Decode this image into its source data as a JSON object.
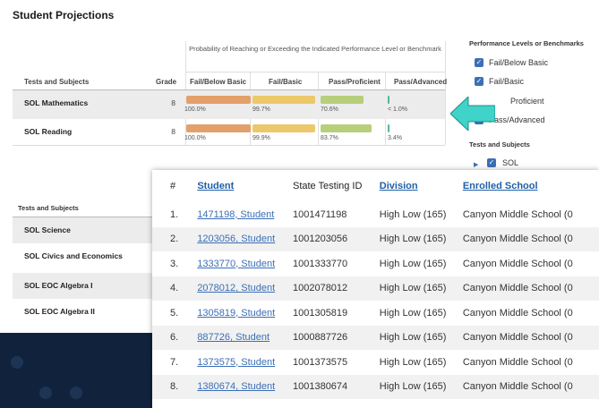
{
  "title": "Student Projections",
  "projection_table": {
    "prob_header": "Probability of Reaching or Exceeding the Indicated Performance Level or Benchmark",
    "col_tests": "Tests and Subjects",
    "col_grade": "Grade",
    "levels": [
      "Fail/Below Basic",
      "Fail/Basic",
      "Pass/Proficient",
      "Pass/Advanced"
    ],
    "rows": [
      {
        "subject": "SOL Mathematics",
        "grade": "8",
        "pcts": [
          "100.0%",
          "99.7%",
          "70.6%",
          "< 1.0%"
        ],
        "values": [
          1.0,
          0.997,
          0.706,
          0.005
        ]
      },
      {
        "subject": "SOL Reading",
        "grade": "8",
        "pcts": [
          "100.0%",
          "99.9%",
          "83.7%",
          "3.4%"
        ],
        "values": [
          1.0,
          0.999,
          0.837,
          0.034
        ]
      }
    ],
    "bar_colors": [
      "#e3a06a",
      "#ecc86a",
      "#b7cf7a",
      "#58b88c"
    ]
  },
  "legend": {
    "heading": "Performance Levels or Benchmarks",
    "items": [
      "Fail/Below Basic",
      "Fail/Basic",
      "Proficient",
      "Pass/Advanced"
    ],
    "tests_heading": "Tests and Subjects",
    "tests_item": "SOL"
  },
  "lower_table": {
    "heading": "Tests and Subjects",
    "rows": [
      "SOL Science",
      "SOL Civics and Economics",
      "SOL EOC Algebra I",
      "SOL EOC Algebra II"
    ]
  },
  "student_table": {
    "headers": {
      "num": "#",
      "student": "Student",
      "state_id": "State Testing ID",
      "division": "Division",
      "school": "Enrolled School"
    },
    "rows": [
      {
        "num": "1.",
        "student": "1471198, Student",
        "state_id": "1001471198",
        "division": "High Low (165)",
        "school": "Canyon Middle School (0"
      },
      {
        "num": "2.",
        "student": "1203056, Student",
        "state_id": "1001203056",
        "division": "High Low (165)",
        "school": "Canyon Middle School (0"
      },
      {
        "num": "3.",
        "student": "1333770, Student",
        "state_id": "1001333770",
        "division": "High Low (165)",
        "school": "Canyon Middle School (0"
      },
      {
        "num": "4.",
        "student": "2078012, Student",
        "state_id": "1002078012",
        "division": "High Low (165)",
        "school": "Canyon Middle School (0"
      },
      {
        "num": "5.",
        "student": "1305819, Student",
        "state_id": "1001305819",
        "division": "High Low (165)",
        "school": "Canyon Middle School (0"
      },
      {
        "num": "6.",
        "student": "887726, Student",
        "state_id": "1000887726",
        "division": "High Low (165)",
        "school": "Canyon Middle School (0"
      },
      {
        "num": "7.",
        "student": "1373575, Student",
        "state_id": "1001373575",
        "division": "High Low (165)",
        "school": "Canyon Middle School (0"
      },
      {
        "num": "8.",
        "student": "1380674, Student",
        "state_id": "1001380674",
        "division": "High Low (165)",
        "school": "Canyon Middle School (0"
      }
    ]
  },
  "icons": {
    "arrow": "pointer-arrow-icon",
    "check": "checkbox-check-icon",
    "caret": "caret-right-icon"
  },
  "colors": {
    "arrow": "#3fd3c9",
    "link": "#3b6fb6",
    "background": "#11223d"
  }
}
